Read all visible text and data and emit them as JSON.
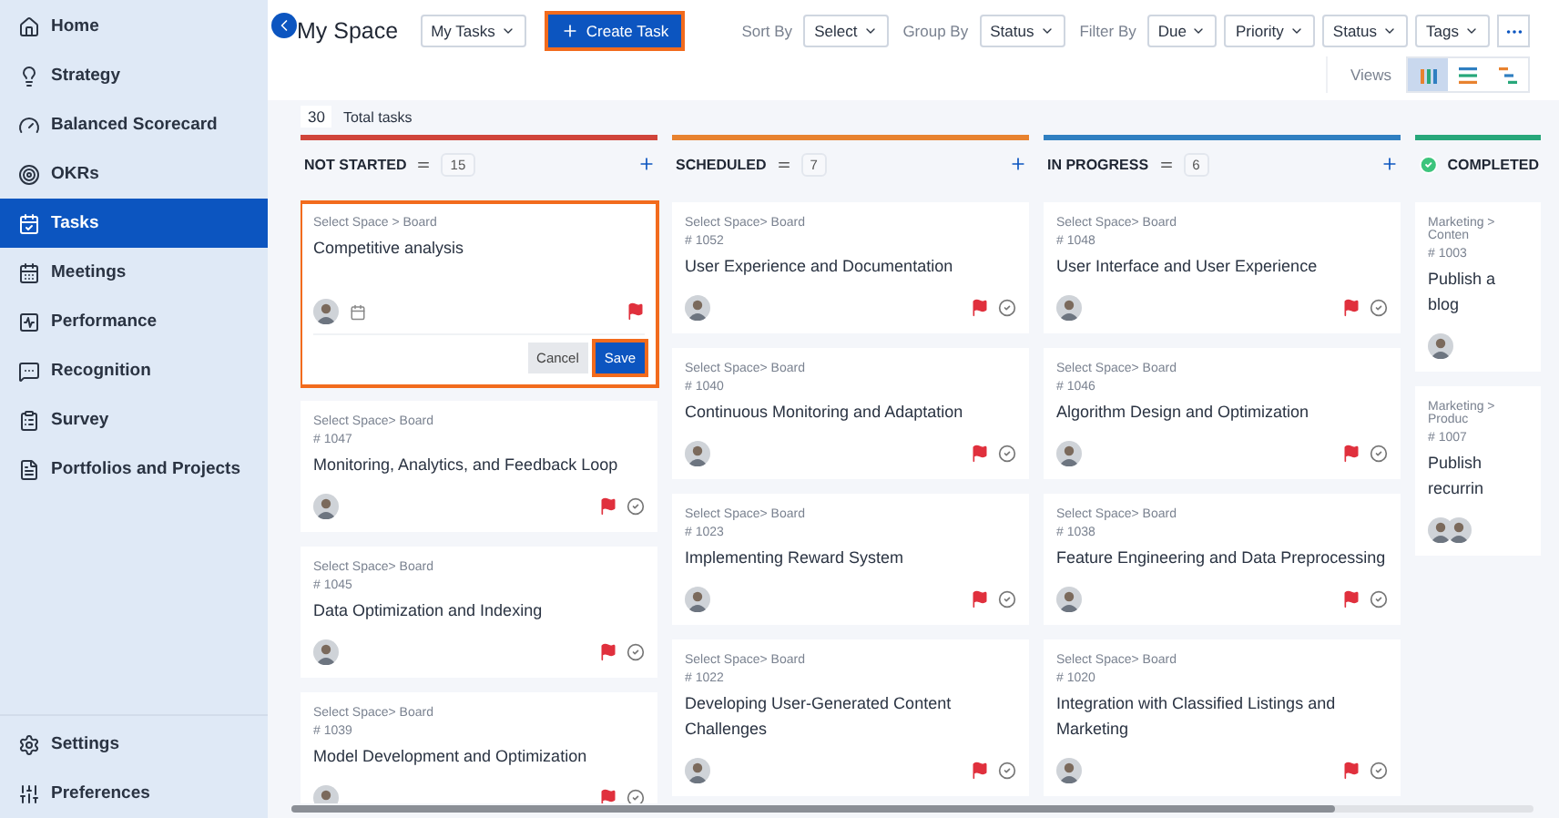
{
  "sidebar": {
    "items": [
      {
        "label": "Home",
        "selected": false
      },
      {
        "label": "Strategy",
        "selected": false
      },
      {
        "label": "Balanced Scorecard",
        "selected": false
      },
      {
        "label": "OKRs",
        "selected": false
      },
      {
        "label": "Tasks",
        "selected": true
      },
      {
        "label": "Meetings",
        "selected": false
      },
      {
        "label": "Performance",
        "selected": false
      },
      {
        "label": "Recognition",
        "selected": false
      },
      {
        "label": "Survey",
        "selected": false
      },
      {
        "label": "Portfolios and Projects",
        "selected": false
      }
    ],
    "footer_items": [
      {
        "label": "Settings"
      },
      {
        "label": "Preferences"
      }
    ]
  },
  "header": {
    "title": "My Space",
    "space_menu": "My Tasks",
    "create_button": "Create Task",
    "sort": {
      "label": "Sort By",
      "value": "Select"
    },
    "group": {
      "label": "Group By",
      "value": "Status"
    },
    "filter": {
      "label": "Filter By",
      "options": [
        "Due",
        "Priority",
        "Status",
        "Tags"
      ]
    },
    "views": {
      "label": "Views",
      "options": [
        {
          "selected": true
        },
        {
          "selected": false
        },
        {
          "selected": false
        }
      ]
    }
  },
  "board": {
    "total": "30",
    "total_label": "Total tasks",
    "columns": [
      {
        "kind": "open",
        "name": "NOT STARTED",
        "color": "#d0443a",
        "count": "15",
        "cards": [
          {
            "kind": "editing",
            "breadcrumb": "Select Space > Board",
            "title": "Competitive analysis",
            "flagged": true,
            "actions": [
              "Cancel",
              "Save"
            ]
          },
          {
            "kind": "task",
            "breadcrumb": "Select Space> Board",
            "number": "# 1047",
            "title": "Monitoring, Analytics, and Feedback Loop",
            "flagged": true,
            "multiple_assignees": false
          },
          {
            "kind": "task",
            "breadcrumb": "Select Space> Board",
            "number": "# 1045",
            "title": "Data Optimization and Indexing",
            "flagged": true,
            "multiple_assignees": false
          },
          {
            "kind": "task",
            "breadcrumb": "Select Space> Board",
            "number": "# 1039",
            "title": "Model Development and Optimization",
            "flagged": true,
            "multiple_assignees": false
          }
        ]
      },
      {
        "kind": "open",
        "name": "SCHEDULED",
        "color": "#e8822f",
        "count": "7",
        "cards": [
          {
            "kind": "task",
            "breadcrumb": "Select Space> Board",
            "number": "# 1052",
            "title": "User Experience and Documentation",
            "flagged": true,
            "multiple_assignees": false
          },
          {
            "kind": "task",
            "breadcrumb": "Select Space> Board",
            "number": "# 1040",
            "title": "Continuous Monitoring and Adaptation",
            "flagged": true,
            "multiple_assignees": false
          },
          {
            "kind": "task",
            "breadcrumb": "Select Space> Board",
            "number": "# 1023",
            "title": "Implementing Reward System",
            "flagged": true,
            "multiple_assignees": false
          },
          {
            "kind": "task",
            "breadcrumb": "Select Space> Board",
            "number": "# 1022",
            "title": "Developing User-Generated Content Challenges",
            "flagged": true,
            "multiple_assignees": false
          }
        ]
      },
      {
        "kind": "open",
        "name": "IN PROGRESS",
        "color": "#2f7fc1",
        "count": "6",
        "cards": [
          {
            "kind": "task",
            "breadcrumb": "Select Space> Board",
            "number": "# 1048",
            "title": "User Interface and User Experience",
            "flagged": true,
            "multiple_assignees": false
          },
          {
            "kind": "task",
            "breadcrumb": "Select Space> Board",
            "number": "# 1046",
            "title": "Algorithm Design and Optimization",
            "flagged": true,
            "multiple_assignees": false
          },
          {
            "kind": "task",
            "breadcrumb": "Select Space> Board",
            "number": "# 1038",
            "title": "Feature Engineering and Data Preprocessing",
            "flagged": true,
            "multiple_assignees": false
          },
          {
            "kind": "task",
            "breadcrumb": "Select Space> Board",
            "number": "# 1020",
            "title": "Integration with Classified Listings and Marketing",
            "flagged": true,
            "multiple_assignees": false
          }
        ]
      },
      {
        "kind": "completed",
        "name": "COMPLETED",
        "color": "#27a77a",
        "cards": [
          {
            "kind": "task",
            "breadcrumb": "Marketing > Conten",
            "number": "# 1003",
            "title": "Publish a blog",
            "flagged": false,
            "multiple_assignees": false
          },
          {
            "kind": "task",
            "breadcrumb": "Marketing > Produc",
            "number": "# 1007",
            "title": "Publish recurrin",
            "flagged": false,
            "multiple_assignees": true
          }
        ]
      }
    ]
  }
}
